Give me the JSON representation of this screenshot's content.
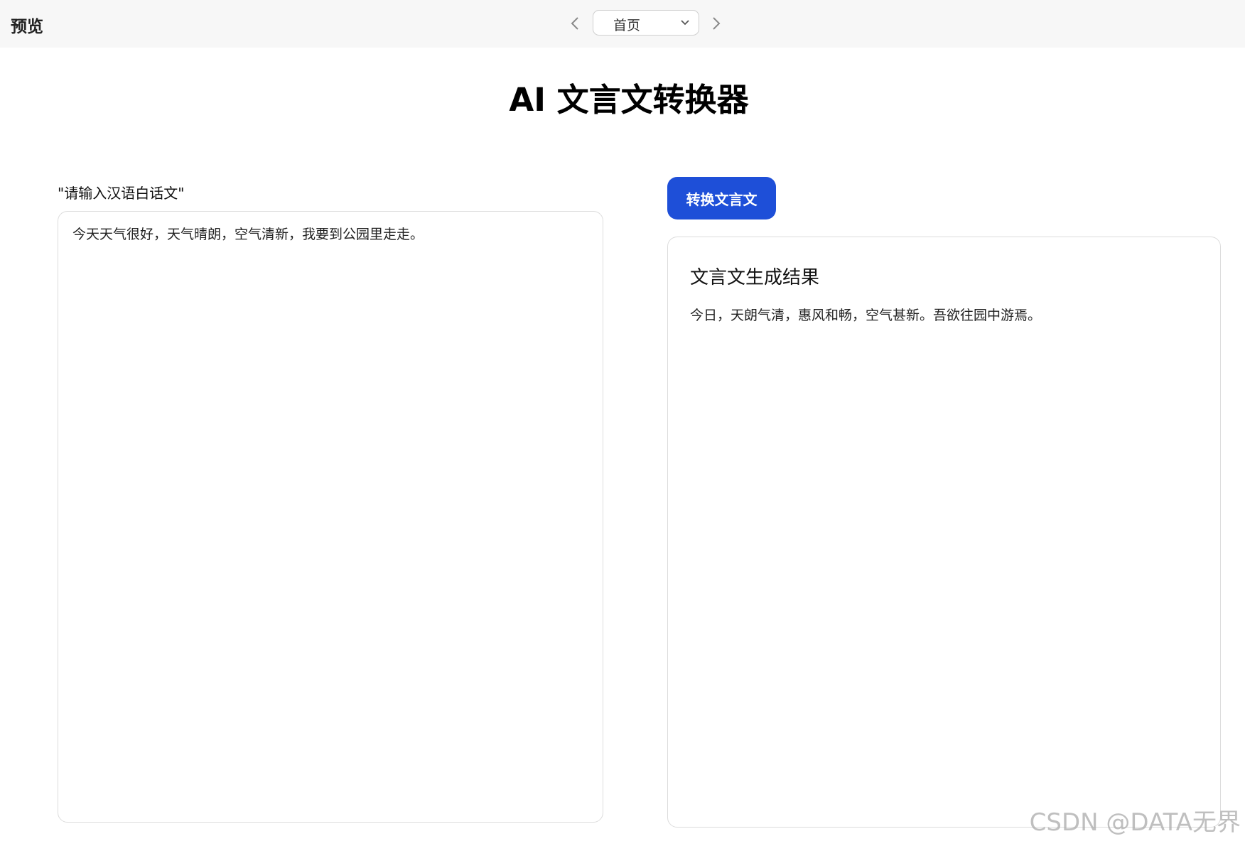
{
  "topbar": {
    "title": "预览",
    "page_select": {
      "value": "首页"
    },
    "prev_icon": "chevron-left-icon",
    "next_icon": "chevron-right-icon"
  },
  "main": {
    "title": "AI 文言文转换器"
  },
  "input": {
    "label": "\"请输入汉语白话文\"",
    "value": "今天天气很好，天气晴朗，空气清新，我要到公园里走走。"
  },
  "convert_button": {
    "label": "转换文言文",
    "color": "#1e4fd8"
  },
  "result": {
    "title": "文言文生成结果",
    "text": "今日，天朗气清，惠风和畅，空气甚新。吾欲往园中游焉。"
  },
  "watermark": "CSDN @DATA无界"
}
